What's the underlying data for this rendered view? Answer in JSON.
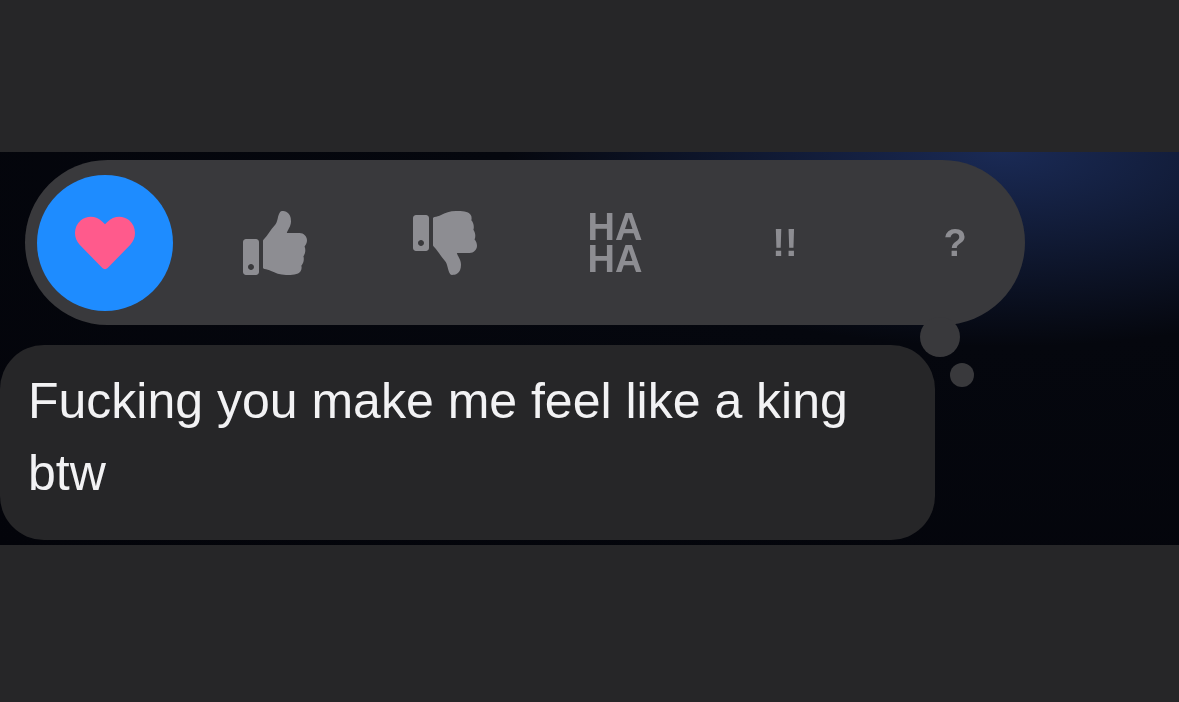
{
  "reactions": [
    {
      "kind": "heart",
      "selected": true
    },
    {
      "kind": "thumbs-up",
      "selected": false
    },
    {
      "kind": "thumbs-down",
      "selected": false
    },
    {
      "kind": "text",
      "label": "HA HA",
      "selected": false
    },
    {
      "kind": "text",
      "label": "!!",
      "selected": false
    },
    {
      "kind": "text",
      "label": "?",
      "selected": false
    }
  ],
  "message": {
    "text": "Fucking you make me feel like a king btw"
  }
}
